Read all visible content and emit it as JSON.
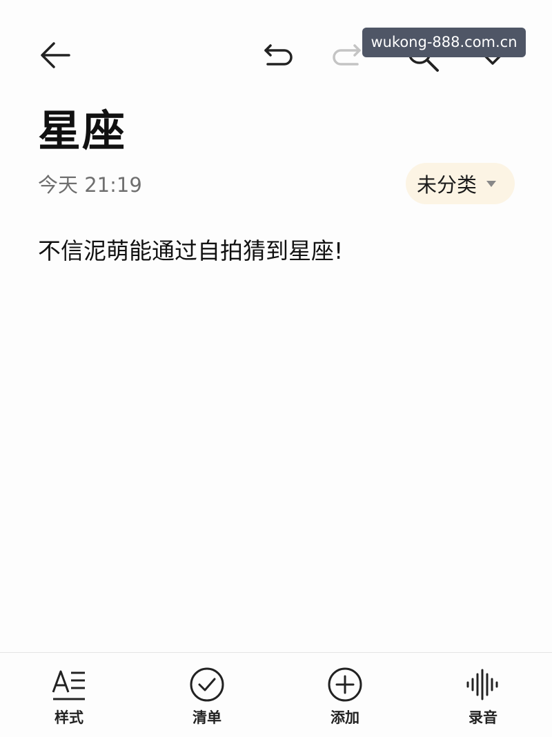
{
  "toolbar": {
    "back_icon": "back-arrow-icon",
    "undo_icon": "undo-icon",
    "redo_icon": "redo-icon",
    "search_icon": "search-icon",
    "done_icon": "checkmark-icon"
  },
  "watermark": "wukong-888.com.cn",
  "note": {
    "title": "星座",
    "date": "今天 21:19",
    "category": "未分类",
    "body": "不信泥萌能通过自拍猜到星座!"
  },
  "bottom_tools": [
    {
      "label": "样式",
      "icon": "text-style-icon"
    },
    {
      "label": "清单",
      "icon": "checklist-icon"
    },
    {
      "label": "添加",
      "icon": "add-circle-icon"
    },
    {
      "label": "录音",
      "icon": "audio-wave-icon"
    }
  ],
  "colors": {
    "background": "#fdfdfd",
    "category_bg": "#fcf4e4",
    "watermark_bg": "#4f5666",
    "muted_text": "#6f6f6f"
  }
}
